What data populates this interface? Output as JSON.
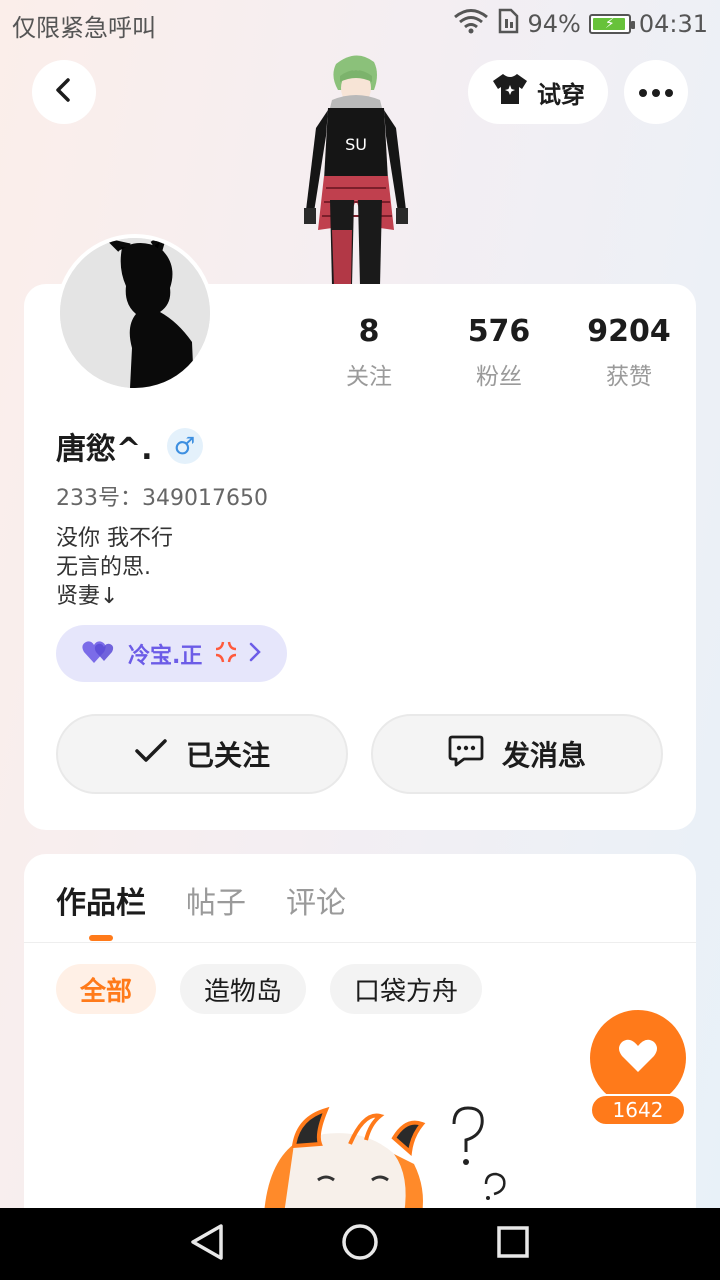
{
  "status_bar": {
    "carrier_text": "仅限紧急呼叫",
    "battery_level": 94,
    "battery_text": "94%",
    "time": "04:31"
  },
  "header": {
    "tryon_label": "试穿",
    "back_icon": "chevron-left-icon",
    "more_icon": "more-dots-icon"
  },
  "profile": {
    "stats": [
      {
        "value": "8",
        "label": "关注"
      },
      {
        "value": "576",
        "label": "粉丝"
      },
      {
        "value": "9204",
        "label": "获赞"
      }
    ],
    "username": "唐慾^.",
    "gender_symbol": "♂",
    "uid_label": "233号：349017650",
    "bio_lines": [
      "没你 我不行",
      "无言的思.",
      "贤妻↓"
    ],
    "guard_name": "冷宝.正",
    "follow_label": "已关注",
    "message_label": "发消息"
  },
  "content": {
    "tabs": [
      {
        "label": "作品栏",
        "active": true
      },
      {
        "label": "帖子",
        "active": false
      },
      {
        "label": "评论",
        "active": false
      }
    ],
    "chips": [
      {
        "label": "全部",
        "active": true
      },
      {
        "label": "造物岛",
        "active": false
      },
      {
        "label": "口袋方舟",
        "active": false
      }
    ]
  },
  "like_fab": {
    "count": "1642"
  },
  "colors": {
    "accent": "#ff7a1a",
    "purple": "#6c5ce7",
    "gender_blue": "#3d8fe0"
  }
}
